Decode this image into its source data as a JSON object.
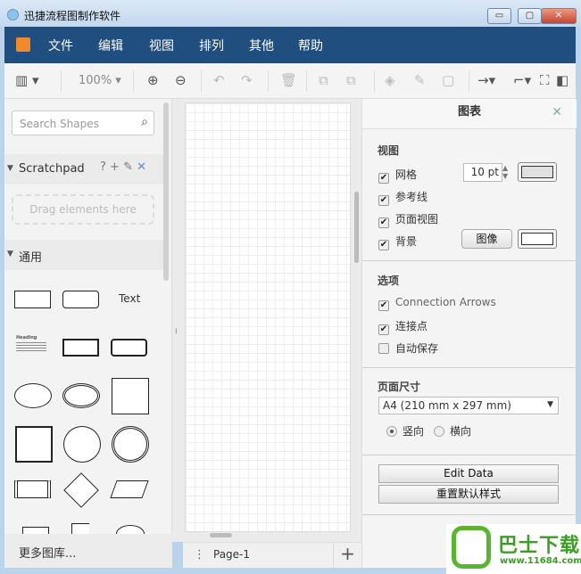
{
  "window": {
    "title": "迅捷流程图制作软件",
    "minimize": "▭",
    "maximize": "▢",
    "close": "✕"
  },
  "menu": [
    "文件",
    "编辑",
    "视图",
    "排列",
    "其他",
    "帮助"
  ],
  "toolbar": {
    "zoom": "100%"
  },
  "sidebar": {
    "search_placeholder": "Search Shapes",
    "scratchpad": "Scratchpad",
    "scratchpad_actions": [
      "?",
      "+",
      "✎",
      "✕"
    ],
    "drag_hint": "Drag elements here",
    "general": "通用",
    "text_shape": "Text",
    "heading_shape": "Heading",
    "more": "更多图库..."
  },
  "pages": {
    "current": "Page-1",
    "add": "+",
    "menu": "⋮"
  },
  "panel": {
    "title": "图表",
    "close": "✕",
    "view": {
      "heading": "视图",
      "grid": "网格",
      "grid_size": "10 pt",
      "guides": "参考线",
      "page_view": "页面视图",
      "background": "背景",
      "image_button": "图像",
      "grid_color": "#e0e0e0",
      "bg_color": "#ffffff"
    },
    "options": {
      "heading": "选项",
      "connection_arrows": "Connection Arrows",
      "connection_points": "连接点",
      "autosave": "自动保存",
      "checked": [
        true,
        true,
        false
      ]
    },
    "page_size": {
      "heading": "页面尺寸",
      "selected": "A4 (210 mm x 297 mm)",
      "portrait": "竖向",
      "landscape": "横向",
      "orientation": "portrait"
    },
    "edit_data": "Edit Data",
    "reset_style": "重置默认样式"
  },
  "watermark": {
    "name": "巴士下载",
    "url": "www.11684.com"
  }
}
